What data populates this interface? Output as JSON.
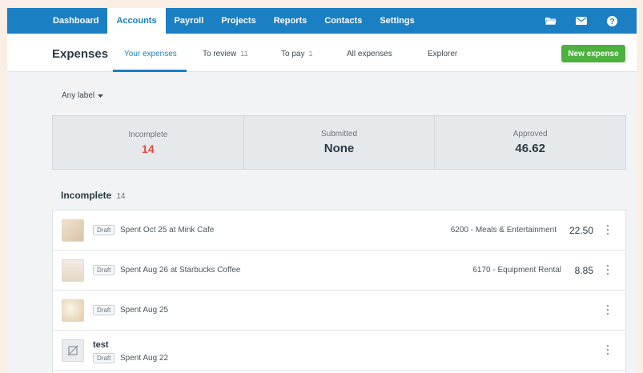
{
  "nav": {
    "items": [
      "Dashboard",
      "Accounts",
      "Payroll",
      "Projects",
      "Reports",
      "Contacts",
      "Settings"
    ],
    "active_index": 1,
    "icons": [
      "folder-icon",
      "mail-icon",
      "help-icon"
    ]
  },
  "subheader": {
    "title": "Expenses",
    "tabs": [
      {
        "label": "Your expenses",
        "count": ""
      },
      {
        "label": "To review",
        "count": "11"
      },
      {
        "label": "To pay",
        "count": "1"
      },
      {
        "label": "All expenses",
        "count": ""
      },
      {
        "label": "Explorer",
        "count": ""
      }
    ],
    "active_tab": 0,
    "new_button": "New expense"
  },
  "filter": {
    "label": "Any label"
  },
  "summary": [
    {
      "label": "Incomplete",
      "value": "14"
    },
    {
      "label": "Submitted",
      "value": "None"
    },
    {
      "label": "Approved",
      "value": "46.62"
    }
  ],
  "section": {
    "title": "Incomplete",
    "count": "14"
  },
  "expenses": [
    {
      "status": "Draft",
      "name": "",
      "description": "Spent Oct 25 at Mink Cafe",
      "account": "6200 - Meals & Entertainment",
      "amount": "22.50"
    },
    {
      "status": "Draft",
      "name": "",
      "description": "Spent Aug 26 at Starbucks Coffee",
      "account": "6170 - Equipment Rental",
      "amount": "8.85"
    },
    {
      "status": "Draft",
      "name": "",
      "description": "Spent Aug 25",
      "account": "",
      "amount": ""
    },
    {
      "status": "Draft",
      "name": "test",
      "description": "Spent Aug 22",
      "account": "",
      "amount": ""
    }
  ],
  "colors": {
    "brand": "#1b7fc4",
    "primary_button": "#4cb13d",
    "alert": "#e2453c"
  }
}
